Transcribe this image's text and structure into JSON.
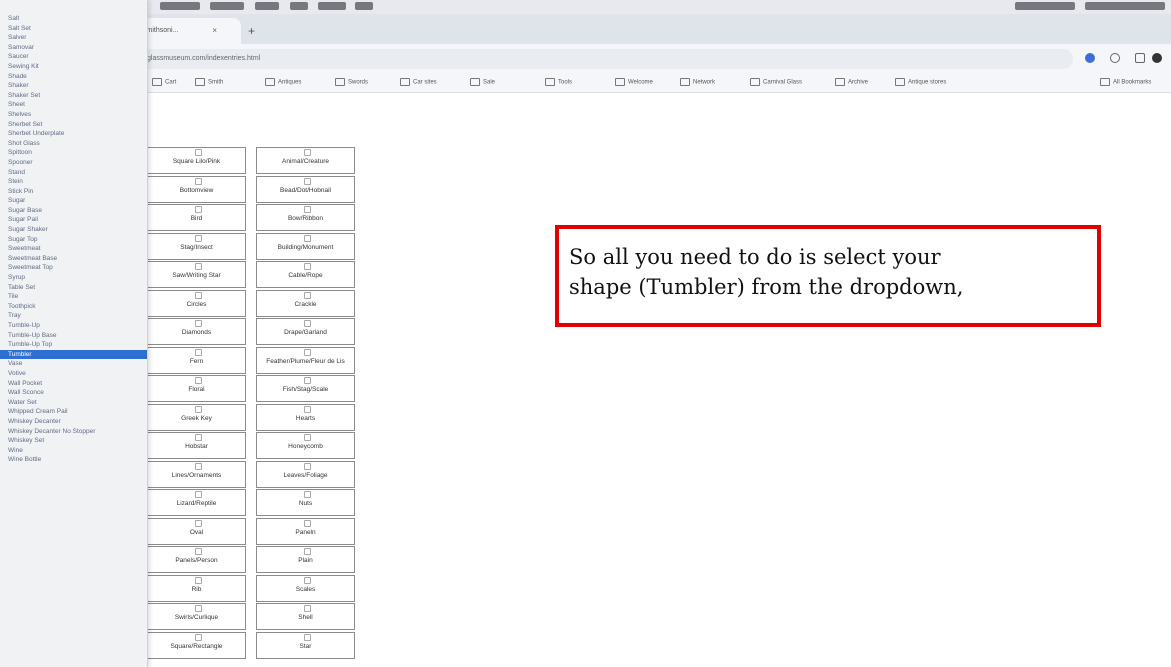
{
  "dropdown": {
    "items": [
      "Salt",
      "Salt Set",
      "Salver",
      "Samovar",
      "Saucer",
      "Sewing Kit",
      "Shade",
      "Shaker",
      "Shaker Set",
      "Sheet",
      "Shelves",
      "Sherbet Set",
      "Sherbet Underplate",
      "Shot Glass",
      "Spittoon",
      "Spooner",
      "Stand",
      "Stein",
      "Stick Pin",
      "Sugar",
      "Sugar Base",
      "Sugar Pail",
      "Sugar Shaker",
      "Sugar Top",
      "Sweetmeat",
      "Sweetmeat Base",
      "Sweetmeat Top",
      "Syrup",
      "Table Set",
      "Tile",
      "Toothpick",
      "Tray",
      "Tumble-Up",
      "Tumble-Up Base",
      "Tumble-Up Top",
      "Tumbler",
      "Vase",
      "Votive",
      "Wall Pocket",
      "Wall Sconce",
      "Water Set",
      "Whipped Cream Pail",
      "Whiskey Decanter",
      "Whiskey Decanter No Stopper",
      "Whiskey Set",
      "Wine",
      "Wine Bottle"
    ],
    "selected": "Tumbler"
  },
  "browser": {
    "tab_title": "smithsoni...",
    "tab_close": "×",
    "new_tab": "+",
    "url": "glassmuseum.com/indexentries.html",
    "bookmarks": [
      "Cart",
      "Smith",
      "Antiques",
      "Swords",
      "Car sites",
      "Sale",
      "Tools",
      "Welcome",
      "Network",
      "Carnival Glass",
      "Archive",
      "Antique stores",
      "All Bookmarks"
    ]
  },
  "pattern_grid": {
    "left_column": [
      "Square Lilo/Pink",
      "Bottomview",
      "Bird",
      "Stag/Insect",
      "Saw/Writing Star",
      "Circles",
      "Diamonds",
      "Fern",
      "Floral",
      "Greek Key",
      "Hobstar",
      "Lines/Ornaments",
      "Lizard/Reptile",
      "Oval",
      "Panels/Person",
      "Rib",
      "Swirls/Curlique",
      "Square/Rectangle"
    ],
    "right_column": [
      "Animal/Creature",
      "Bead/Dot/Hobnail",
      "Bow/Ribbon",
      "Building/Monument",
      "Cable/Rope",
      "Crackle",
      "Drape/Garland",
      "Feather/Plume/Fleur de Lis",
      "Fish/Stag/Scale",
      "Hearts",
      "Honeycomb",
      "Leaves/Foliage",
      "Nuts",
      "Paneln",
      "Plain",
      "Scales",
      "Shell",
      "Star"
    ]
  },
  "caption": {
    "line1": "So all you need to do is select your",
    "line2": "shape (Tumbler) from the dropdown,"
  },
  "colors": {
    "highlight": "#2f6fd1",
    "caption_border": "#e00000"
  }
}
